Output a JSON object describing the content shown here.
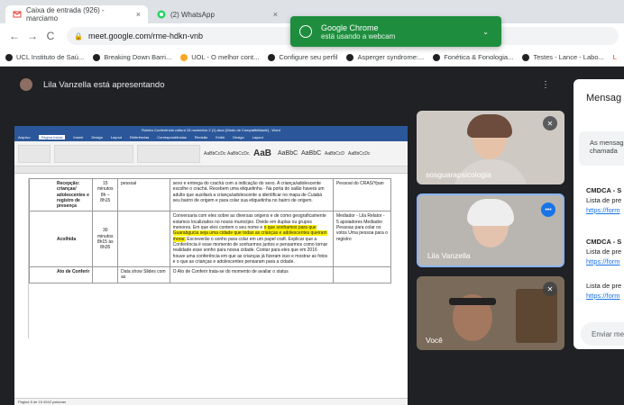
{
  "browser": {
    "tabs": [
      {
        "title": "Caixa de entrada (926) - marciamo",
        "close": "×"
      },
      {
        "title": "(2) WhatsApp",
        "close": "×"
      }
    ],
    "url": "meet.google.com/rme-hdkn-vnb",
    "bookmarks": [
      "UCL Instituto de Saú...",
      "Breaking Down Barri...",
      "UOL - O melhor cont...",
      "Configure seu perfil",
      "Asperger syndrome:...",
      "Fonética & Fonologia...",
      "Testes - Lance - Labo..."
    ],
    "bookmark_extra": "L"
  },
  "notification": {
    "title": "Google Chrome",
    "body": "está usando a webcam"
  },
  "meet": {
    "presenter_text": "Lila Vanzella está apresentando",
    "participants": [
      {
        "name": "sosguarapsicologia"
      },
      {
        "name": "Lila Vanzella"
      },
      {
        "name": "Você"
      }
    ],
    "chat": {
      "title": "Mensag",
      "info_line1": "As mensag",
      "info_line2": "chamada",
      "messages": [
        {
          "sender": "CMDCA - S",
          "text": "Lista de pre",
          "link": "https://form"
        },
        {
          "sender": "CMDCA - S",
          "text": "Lista de pre",
          "link": "https://form"
        },
        {
          "sender": "",
          "text": "Lista de pre",
          "link": "https://form"
        }
      ],
      "input_placeholder": "Enviar me"
    }
  },
  "document": {
    "window_title": "Roteiro Conferência cultura 15 novembro 2 (1).docx [Modo de Compatibilidade] - Word",
    "ribbon_tabs": [
      "Arquivo",
      "Página Inicial",
      "Inserir",
      "Design",
      "Layout",
      "Referências",
      "Correspondências",
      "Revisão",
      "Exibir",
      "Design",
      "Layout"
    ],
    "styles": [
      "AaBbCcDc",
      "AaBbCcDc",
      "AaB",
      "AaBbC",
      "AaBbC",
      "AaBbCcD",
      "AaBbCcDc"
    ],
    "rows": [
      {
        "label": "Recepção: crianças/ adolescentes e registro de presença",
        "time": "15 minutos 8h – 8h15",
        "resource": "pessoal",
        "description": "sexo e entrega do crachá com a indicação do sexo. A criança/adolescente escolhe o crachá. Recebem uma etiquetinha - Na porta do salão haverá um adulto que auxiliará a criança/adolescente a identificar no mapa de Cuiabá seu bairro de origem e para colar sua etiquetinha no bairro de origem.",
        "responsible": "Pessoal do CRAS/Ypan"
      },
      {
        "label": "Acolhida",
        "time": "30 minutos 8h15 às 8h35",
        "resource": "",
        "desc_a": "Conversaria com eles sobre as diversas origens e de como geograficamente estamos localizados no nosso município. Divide em duplas ou grupos menores. Em que eles contem o seu nome e ",
        "desc_hl": "o que sonhamos para que Guarabgucia seja uma cidade que todas as crianças e adolescentes queiram morar.",
        "desc_b": " Escreverão o sonho para colar em um papel craft. Explicar que a Conferência é esse momento de sonharmos juntos e pensarmos como tornar realidade esse sonho para nossa cidade. Contar para eles que em 2016 houve uma conferência em que as crianças já fizeram isso e mostrar as fotos e o que as crianças e adolescentes pensaram para a cidade.",
        "responsible": "Mediador - Lila Relator - 5 apoiadores Mediador Pessoas para colar os votos Uma pessoa para o registro"
      },
      {
        "label": "Ato de Conferir",
        "time": "",
        "resource": "Data show Slides com as",
        "description": "O Ato de Conferir trata-se do momento de avaliar o status",
        "responsible": ""
      }
    ],
    "status": "Página 5 de 15    4942 palavras"
  }
}
